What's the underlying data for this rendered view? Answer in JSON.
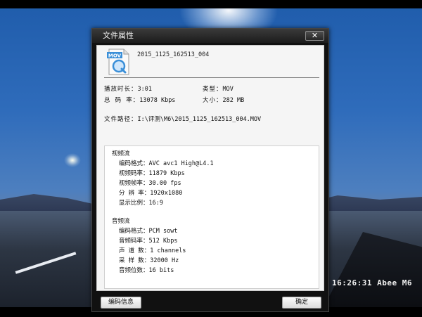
{
  "osd_timestamp": "16:26:31",
  "osd_brand": "Abee M6",
  "dialog": {
    "title": "文件属性",
    "close_label": "✕",
    "file_name": "2015_1125_162513_004",
    "file_icon_text": "MOV",
    "duration_label": "播放时长：",
    "duration_value": "3:01",
    "type_label": "类型：",
    "type_value": "MOV",
    "bitrate_label": "总 码 率：",
    "bitrate_value": "13078 Kbps",
    "size_label": "大小：",
    "size_value": "282 MB",
    "path_label": "文件路径：",
    "path_value": "I:\\评测\\M6\\2015_1125_162513_004.MOV",
    "video": {
      "heading": "视频流",
      "codec_label": "编码格式：",
      "codec_value": "AVC avc1 High@L4.1",
      "bitrate_label": "视频码率：",
      "bitrate_value": "11879 Kbps",
      "fps_label": "视频帧率：",
      "fps_value": "30.00 fps",
      "resolution_label": "分 辨 率：",
      "resolution_value": "1920x1080",
      "aspect_label": "显示比例：",
      "aspect_value": "16:9"
    },
    "audio": {
      "heading": "音频流",
      "codec_label": "编码格式：",
      "codec_value": "PCM sowt",
      "bitrate_label": "音频码率：",
      "bitrate_value": "512 Kbps",
      "channels_label": "声 道 数：",
      "channels_value": "1 channels",
      "samplerate_label": "采 样 数：",
      "samplerate_value": "32000 Hz",
      "bits_label": "音频位数：",
      "bits_value": "16 bits"
    },
    "codec_info_button": "编码信息",
    "ok_button": "确定"
  }
}
